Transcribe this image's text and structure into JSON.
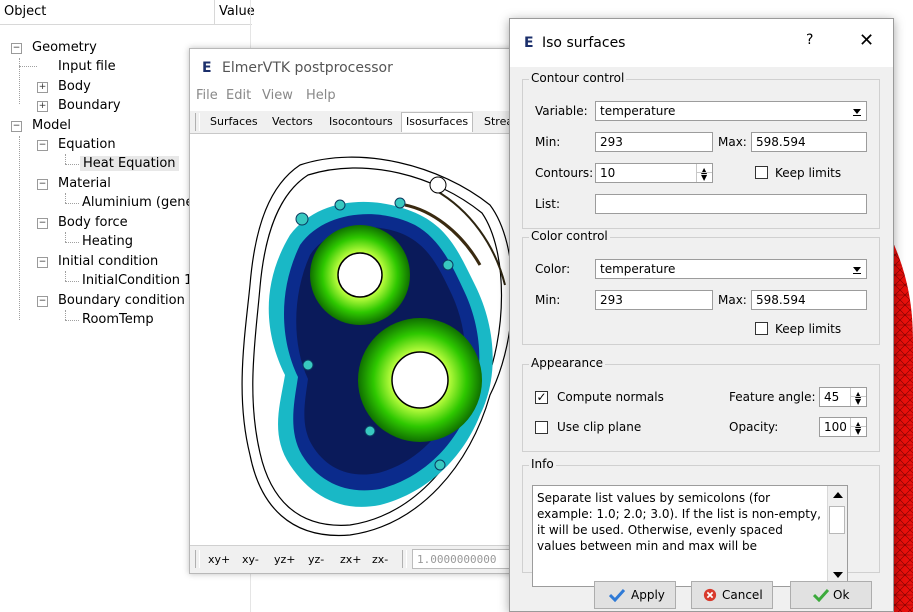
{
  "tree": {
    "headers": [
      "Object",
      "Value"
    ],
    "items": [
      {
        "label": "Geometry",
        "expander": "−"
      },
      {
        "label": "Input file",
        "expander": ""
      },
      {
        "label": "Body",
        "expander": "+"
      },
      {
        "label": "Boundary",
        "expander": "+"
      },
      {
        "label": "Model",
        "expander": "−"
      },
      {
        "label": "Equation",
        "expander": "−"
      },
      {
        "label": "Heat Equation",
        "expander": ""
      },
      {
        "label": "Material",
        "expander": "−"
      },
      {
        "label": "Aluminium (gene",
        "expander": ""
      },
      {
        "label": "Body force",
        "expander": "−"
      },
      {
        "label": "Heating",
        "expander": ""
      },
      {
        "label": "Initial condition",
        "expander": "−"
      },
      {
        "label": "InitialCondition 1",
        "expander": ""
      },
      {
        "label": "Boundary condition",
        "expander": "−"
      },
      {
        "label": "RoomTemp",
        "expander": ""
      }
    ]
  },
  "vtk": {
    "logo": "E",
    "title": "ElmerVTK postprocessor",
    "menu": [
      "File",
      "Edit",
      "View",
      "Help"
    ],
    "tabs": [
      "Surfaces",
      "Vectors",
      "Isocontours",
      "Isosurfaces",
      "Strea"
    ],
    "view_buttons": [
      "xy+",
      "xy-",
      "yz+",
      "yz-",
      "zx+",
      "zx-"
    ],
    "scale_value": "1.0000000000"
  },
  "dialog": {
    "logo": "E",
    "title": "Iso surfaces",
    "help": "?",
    "close": "✕",
    "contour_control": {
      "title": "Contour control",
      "variable_label": "Variable:",
      "variable_value": "temperature",
      "min_label": "Min:",
      "min_value": "293",
      "max_label": "Max:",
      "max_value": "598.594",
      "contours_label": "Contours:",
      "contours_value": "10",
      "keep_limits_label": "Keep limits",
      "keep_limits_checked": false,
      "list_label": "List:",
      "list_value": ""
    },
    "color_control": {
      "title": "Color control",
      "color_label": "Color:",
      "color_value": "temperature",
      "min_label": "Min:",
      "min_value": "293",
      "max_label": "Max:",
      "max_value": "598.594",
      "keep_limits_label": "Keep limits",
      "keep_limits_checked": false
    },
    "appearance": {
      "title": "Appearance",
      "compute_normals_label": "Compute normals",
      "compute_normals_checked": true,
      "compute_normals_mark": "✓",
      "feature_angle_label": "Feature angle:",
      "feature_angle_value": "45",
      "use_clip_plane_label": "Use clip plane",
      "use_clip_plane_checked": false,
      "opacity_label": "Opacity:",
      "opacity_value": "100"
    },
    "info": {
      "title": "Info",
      "text": "Separate list values by semicolons (for example: 1.0; 2.0; 3.0). If the list is non-empty, it will be used. Otherwise, evenly spaced values between min and max will be"
    },
    "buttons": {
      "apply": "Apply",
      "cancel": "Cancel",
      "ok": "Ok"
    }
  }
}
